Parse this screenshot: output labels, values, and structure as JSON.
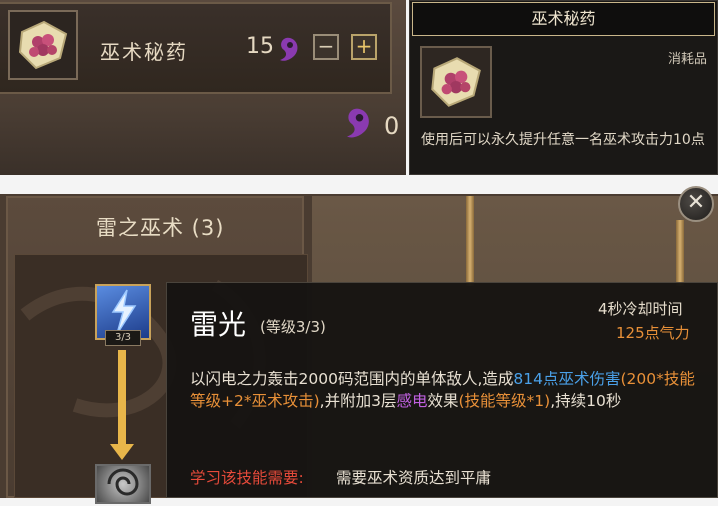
{
  "shop": {
    "item_name": "巫术秘药",
    "count": "15",
    "minus_label": "−",
    "plus_label": "+",
    "total": "0",
    "currency_icon": "purple-magatama-icon",
    "item_icon": "herb-pouch-icon"
  },
  "item_tooltip": {
    "title": "巫术秘药",
    "category": "消耗品",
    "description": "使用后可以永久提升任意一名巫术攻击力10点"
  },
  "skill_tree": {
    "title": "雷之巫术 (3)",
    "node_level": "3/3",
    "close_label": "✕"
  },
  "skill_tooltip": {
    "name": "雷光",
    "level": "(等级3/3)",
    "cooldown": "4秒冷却时间",
    "cost": "125点气力",
    "desc_part1": "以闪电之力轰击2000码范围内的单体敌人,造成",
    "desc_damage": "814点巫术伤害",
    "desc_formula": "(200*技能等级+2*巫术攻击)",
    "desc_part2": ",并附加3层",
    "desc_effect": "感电",
    "desc_part3": "效果",
    "desc_effect_formula": "(技能等级*1)",
    "desc_part4": ",持续10秒",
    "requirement_label": "学习该技能需要:",
    "requirement_value": "需要巫术资质达到平庸"
  },
  "colors": {
    "highlight_blue": "#4aa0e8",
    "highlight_orange": "#e89038",
    "highlight_purple": "#c060e0",
    "requirement_red": "#e64a3a"
  }
}
